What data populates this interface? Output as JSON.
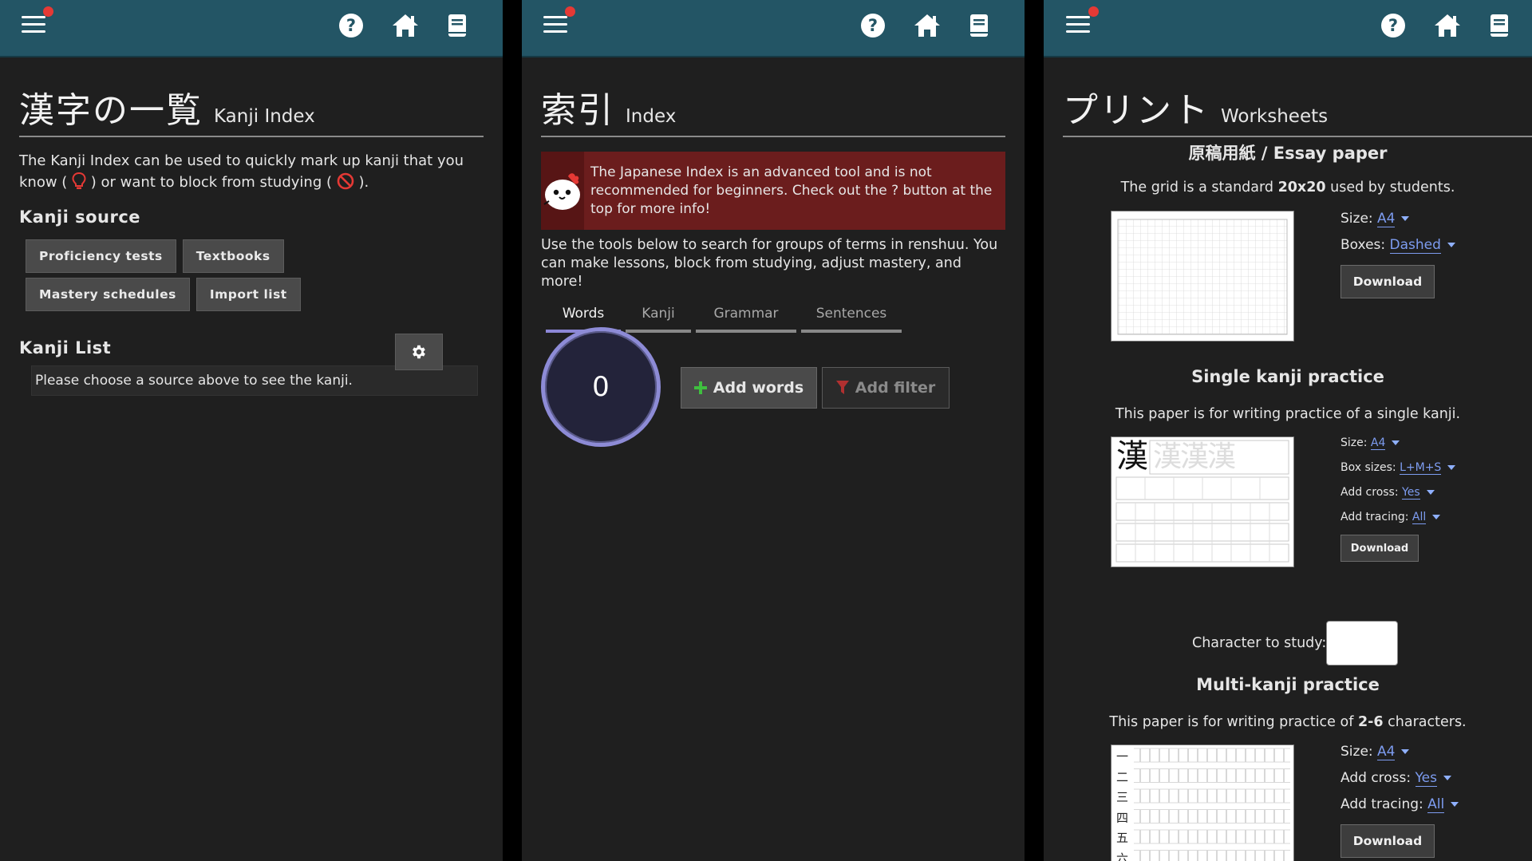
{
  "header": {
    "menu_icon": "hamburger-menu-icon",
    "icons": [
      "help-icon",
      "home-icon",
      "book-icon"
    ]
  },
  "kanji_index": {
    "title_jp": "漢字の一覧",
    "title_en": "Kanji Index",
    "intro_part1": "The Kanji Index can be used to quickly mark up kanji that you know (",
    "intro_part2": ") or want to block from studying (",
    "intro_part3": ").",
    "source_heading": "Kanji source",
    "source_buttons": [
      "Proficiency tests",
      "Textbooks",
      "Mastery schedules",
      "Import list"
    ],
    "list_heading": "Kanji List",
    "list_placeholder": "Please choose a source above to see the kanji."
  },
  "index": {
    "title_jp": "索引",
    "title_en": "Index",
    "warning": "The Japanese Index is an advanced tool and is not recommended for beginners. Check out the ? button at the top for more info!",
    "description": "Use the tools below to search for groups of terms in renshuu. You can make lessons, block from studying, adjust mastery, and more!",
    "tabs": [
      "Words",
      "Kanji",
      "Grammar",
      "Sentences"
    ],
    "active_tab": "Words",
    "counter": "0",
    "add_words": "Add words",
    "add_filter": "Add filter"
  },
  "print": {
    "title_jp": "プリント",
    "title_en": "Worksheets",
    "essay": {
      "title": "原稿用紙 / Essay paper",
      "desc_part1": "The grid is a standard ",
      "desc_bold": "20x20",
      "desc_part2": " used by students.",
      "size_label": "Size:",
      "size_value": "A4",
      "boxes_label": "Boxes:",
      "boxes_value": "Dashed",
      "download": "Download"
    },
    "single": {
      "title": "Single kanji practice",
      "desc": "This paper is for writing practice of a single kanji.",
      "sample_char": "漢",
      "size_label": "Size:",
      "size_value": "A4",
      "box_label": "Box sizes:",
      "box_value": "L+M+S",
      "cross_label": "Add cross:",
      "cross_value": "Yes",
      "tracing_label": "Add tracing:",
      "tracing_value": "All",
      "download": "Download",
      "char_label": "Character to study:"
    },
    "multi": {
      "title": "Multi-kanji practice",
      "desc_part1": "This paper is for writing practice of ",
      "desc_bold": "2-6",
      "desc_part2": " characters.",
      "sample_chars": [
        "一",
        "二",
        "三",
        "四",
        "五",
        "六"
      ],
      "size_label": "Size:",
      "size_value": "A4",
      "cross_label": "Add cross:",
      "cross_value": "Yes",
      "tracing_label": "Add tracing:",
      "tracing_value": "All",
      "download": "Download"
    }
  }
}
